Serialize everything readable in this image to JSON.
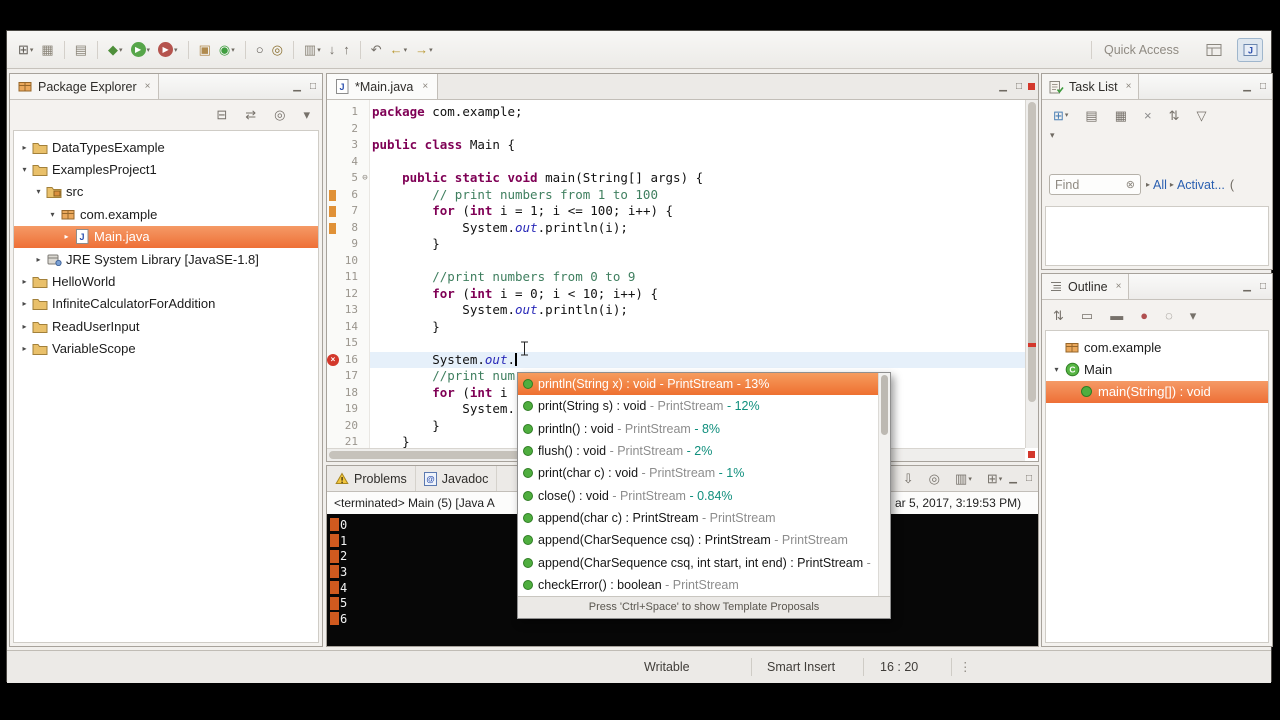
{
  "chrome": {
    "minimize": "▁",
    "maximize": "□",
    "close": "×",
    "dropdown": "▾",
    "fold": "⊖",
    "clear": "⊗",
    "dots": "⋮",
    "arrow_right": "▸",
    "arrow_down": "▾",
    "error_x": "×"
  },
  "toolbar": {
    "quick_access": "Quick Access",
    "buttons": [
      {
        "n": "new-wizard",
        "g": "⊞",
        "c": "#5f5b55",
        "dd": true
      },
      {
        "n": "save",
        "g": "▦",
        "c": "#8a8478"
      },
      {
        "sep": true
      },
      {
        "n": "print",
        "g": "▤",
        "c": "#8a8478"
      },
      {
        "sep": true
      },
      {
        "n": "debug",
        "g": "◆",
        "c": "#4e8f3a",
        "dd": true
      },
      {
        "n": "run",
        "g": "▶",
        "c": "#ffffff",
        "bg": "#57a64a",
        "dd": true
      },
      {
        "n": "run-external-tools",
        "g": "▶",
        "c": "#ffffff",
        "bg": "#b5544e",
        "dd": true
      },
      {
        "sep": true
      },
      {
        "n": "new-java-project",
        "g": "▣",
        "c": "#b08a4e"
      },
      {
        "n": "new-java-class",
        "g": "◉",
        "c": "#3f9e3f",
        "dd": true
      },
      {
        "sep": true
      },
      {
        "n": "open-type",
        "g": "○",
        "c": "#5f5b55"
      },
      {
        "n": "search",
        "g": "◎",
        "c": "#8a6f2f"
      },
      {
        "sep": true
      },
      {
        "n": "coverage",
        "g": "▥",
        "c": "#8a8478",
        "dd": true
      },
      {
        "n": "next-annotation",
        "g": "↓",
        "c": "#76716a"
      },
      {
        "n": "previous-annotation",
        "g": "↑",
        "c": "#76716a"
      },
      {
        "sep": true
      },
      {
        "n": "last-edit-location",
        "g": "↶",
        "c": "#76716a"
      },
      {
        "n": "back",
        "g": "←",
        "c": "#b8962e",
        "dd": true
      },
      {
        "n": "forward",
        "g": "→",
        "c": "#b8962e",
        "dd": true
      }
    ]
  },
  "package_explorer": {
    "title": "Package Explorer",
    "toolbar": [
      {
        "n": "collapse-all",
        "g": "⊟",
        "c": "#76716a"
      },
      {
        "n": "link-with-editor",
        "g": "⇄",
        "c": "#76716a"
      },
      {
        "n": "focus",
        "g": "◎",
        "c": "#76716a"
      },
      {
        "n": "view-menu",
        "g": "▾",
        "c": "#76716a"
      }
    ],
    "items": [
      {
        "label": "DataTypesExample",
        "indent": 0,
        "arrow": "right",
        "icon": "folder"
      },
      {
        "label": "ExamplesProject1",
        "indent": 0,
        "arrow": "down",
        "icon": "folder"
      },
      {
        "label": "src",
        "indent": 1,
        "arrow": "down",
        "icon": "srcfolder"
      },
      {
        "label": "com.example",
        "indent": 2,
        "arrow": "down",
        "icon": "package"
      },
      {
        "label": "Main.java",
        "indent": 3,
        "arrow": "right",
        "icon": "javafile",
        "selected": true
      },
      {
        "label": "JRE System Library [JavaSE-1.8]",
        "indent": 1,
        "arrow": "right",
        "icon": "library"
      },
      {
        "label": "HelloWorld",
        "indent": 0,
        "arrow": "right",
        "icon": "folder"
      },
      {
        "label": "InfiniteCalculatorForAddition",
        "indent": 0,
        "arrow": "right",
        "icon": "folder"
      },
      {
        "label": "ReadUserInput",
        "indent": 0,
        "arrow": "right",
        "icon": "folder"
      },
      {
        "label": "VariableScope",
        "indent": 0,
        "arrow": "right",
        "icon": "folder"
      }
    ]
  },
  "editor": {
    "tab": "*Main.java",
    "lines": [
      {
        "n": 1,
        "t": [
          [
            "kw",
            "package"
          ],
          [
            "pl",
            " com.example;"
          ]
        ]
      },
      {
        "n": 2,
        "t": []
      },
      {
        "n": 3,
        "t": [
          [
            "kw",
            "public class"
          ],
          [
            "pl",
            " Main {"
          ]
        ]
      },
      {
        "n": 4,
        "t": []
      },
      {
        "n": 5,
        "fold": true,
        "t": [
          [
            "pl",
            "    "
          ],
          [
            "kw",
            "public static void"
          ],
          [
            "pl",
            " main(String[] args) {"
          ]
        ]
      },
      {
        "n": 6,
        "diff": true,
        "t": [
          [
            "pl",
            "        "
          ],
          [
            "com",
            "// print numbers from 1 to 100"
          ]
        ]
      },
      {
        "n": 7,
        "diff": true,
        "t": [
          [
            "pl",
            "        "
          ],
          [
            "kw",
            "for"
          ],
          [
            "pl",
            " ("
          ],
          [
            "kw",
            "int"
          ],
          [
            "pl",
            " i = 1; i <= 100; i++) {"
          ]
        ]
      },
      {
        "n": 8,
        "diff": true,
        "t": [
          [
            "pl",
            "            System."
          ],
          [
            "fld",
            "out"
          ],
          [
            "pl",
            ".println(i);"
          ]
        ]
      },
      {
        "n": 9,
        "t": [
          [
            "pl",
            "        }"
          ]
        ]
      },
      {
        "n": 10,
        "t": []
      },
      {
        "n": 11,
        "t": [
          [
            "pl",
            "        "
          ],
          [
            "com",
            "//print numbers from 0 to 9"
          ]
        ]
      },
      {
        "n": 12,
        "t": [
          [
            "pl",
            "        "
          ],
          [
            "kw",
            "for"
          ],
          [
            "pl",
            " ("
          ],
          [
            "kw",
            "int"
          ],
          [
            "pl",
            " i = 0; i < 10; i++) {"
          ]
        ]
      },
      {
        "n": 13,
        "t": [
          [
            "pl",
            "            System."
          ],
          [
            "fld",
            "out"
          ],
          [
            "pl",
            ".println(i);"
          ]
        ]
      },
      {
        "n": 14,
        "t": [
          [
            "pl",
            "        }"
          ]
        ]
      },
      {
        "n": 15,
        "t": []
      },
      {
        "n": 16,
        "current": true,
        "error": true,
        "caret": true,
        "t": [
          [
            "pl",
            "        System."
          ],
          [
            "fld",
            "out"
          ],
          [
            "pl",
            "."
          ]
        ]
      },
      {
        "n": 17,
        "t": [
          [
            "pl",
            "        "
          ],
          [
            "com",
            "//print num"
          ]
        ]
      },
      {
        "n": 18,
        "t": [
          [
            "pl",
            "        "
          ],
          [
            "kw",
            "for"
          ],
          [
            "pl",
            " ("
          ],
          [
            "kw",
            "int"
          ],
          [
            "pl",
            " i"
          ]
        ]
      },
      {
        "n": 19,
        "t": [
          [
            "pl",
            "            System."
          ]
        ]
      },
      {
        "n": 20,
        "t": [
          [
            "pl",
            "        }"
          ]
        ]
      },
      {
        "n": 21,
        "t": [
          [
            "pl",
            "    }"
          ]
        ]
      }
    ]
  },
  "completion": {
    "items": [
      {
        "label": "println(String x) : void",
        "context": "PrintStream",
        "pct": "13%",
        "selected": true
      },
      {
        "label": "print(String s) : void",
        "context": "PrintStream",
        "pct": "12%"
      },
      {
        "label": "println() : void",
        "context": "PrintStream",
        "pct": "8%"
      },
      {
        "label": "flush() : void",
        "context": "PrintStream",
        "pct": "2%"
      },
      {
        "label": "print(char c) : void",
        "context": "PrintStream",
        "pct": "1%"
      },
      {
        "label": "close() : void",
        "context": "PrintStream",
        "pct": "0.84%"
      },
      {
        "label": "append(char c) : PrintStream",
        "context": "PrintStream"
      },
      {
        "label": "append(CharSequence csq) : PrintStream",
        "context": "PrintStream"
      },
      {
        "label": "append(CharSequence csq, int start, int end) : PrintStream",
        "context": "PrintStream"
      },
      {
        "label": "checkError() : boolean",
        "context": "PrintStream"
      }
    ],
    "footer": "Press 'Ctrl+Space' to show Template Proposals"
  },
  "console": {
    "tabs": [
      {
        "label": "Problems",
        "icon": "problems"
      },
      {
        "label": "Javadoc",
        "icon": "javadoc"
      }
    ],
    "icons": [
      {
        "n": "terminate",
        "g": "■",
        "c": "#c2463c"
      },
      {
        "n": "remove-launch",
        "g": "×",
        "c": "#8a8a8a"
      },
      {
        "n": "remove-all-terminated",
        "g": "×",
        "c": "#b9b5ae"
      },
      {
        "n": "clear-console",
        "g": "▤",
        "c": "#76716a"
      },
      {
        "n": "scroll-lock",
        "g": "⇩",
        "c": "#76716a"
      },
      {
        "n": "pin-console",
        "g": "◎",
        "c": "#76716a"
      },
      {
        "n": "display-selected-console",
        "g": "▥",
        "c": "#76716a",
        "dd": true
      },
      {
        "n": "open-console",
        "g": "⊞",
        "c": "#76716a",
        "dd": true
      }
    ],
    "status_left": "<terminated> Main (5) [Java A",
    "status_right": "ar 5, 2017, 3:19:53 PM)",
    "output": [
      "0",
      "1",
      "2",
      "3",
      "4",
      "5",
      "6"
    ]
  },
  "task_list": {
    "title": "Task List",
    "toolbar": [
      {
        "n": "new-task",
        "g": "⊞",
        "c": "#4a7fb5",
        "dd": true
      },
      {
        "n": "categorized",
        "g": "▤",
        "c": "#76716a"
      },
      {
        "n": "scheduled",
        "g": "▦",
        "c": "#76716a"
      },
      {
        "n": "delete-task",
        "g": "×",
        "c": "#8a8a8a"
      },
      {
        "n": "synchronize",
        "g": "⇅",
        "c": "#76716a"
      },
      {
        "n": "filter-completed",
        "g": "▽",
        "c": "#76716a"
      }
    ],
    "find_label": "Find",
    "links": [
      {
        "label": "All"
      },
      {
        "label": "Activat..."
      }
    ],
    "trailing": "("
  },
  "outline": {
    "title": "Outline",
    "toolbar": [
      {
        "n": "sort",
        "g": "⇅",
        "c": "#76716a"
      },
      {
        "n": "hide-fields",
        "g": "▭",
        "c": "#76716a"
      },
      {
        "n": "hide-static-members",
        "g": "▬",
        "c": "#76716a"
      },
      {
        "n": "hide-non-public",
        "g": "●",
        "c": "#b05050"
      },
      {
        "n": "hide-local-types",
        "g": "◌",
        "c": "#76716a"
      },
      {
        "n": "view-menu",
        "g": "▾",
        "c": "#76716a"
      }
    ],
    "items": [
      {
        "label": "com.example",
        "indent": 0,
        "icon": "package"
      },
      {
        "label": "Main",
        "indent": 0,
        "arrow": "down",
        "icon": "class"
      },
      {
        "label": "main(String[]) : void",
        "indent": 1,
        "icon": "method",
        "selected": true
      }
    ]
  },
  "status_bar": {
    "writable": "Writable",
    "insert_mode": "Smart Insert",
    "position": "16 : 20"
  }
}
